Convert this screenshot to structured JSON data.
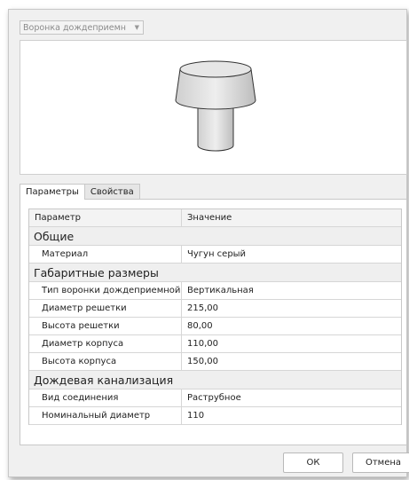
{
  "family_select": {
    "value": "Воронка дождеприемн"
  },
  "tabs": [
    {
      "label": "Параметры",
      "active": true
    },
    {
      "label": "Свойства",
      "active": false
    }
  ],
  "grid": {
    "columns": [
      "Параметр",
      "Значение"
    ],
    "groups": [
      {
        "name": "Общие",
        "rows": [
          {
            "param": "Материал",
            "value": "Чугун серый"
          }
        ]
      },
      {
        "name": "Габаритные размеры",
        "rows": [
          {
            "param": "Тип воронки дождеприемной",
            "value": "Вертикальная"
          },
          {
            "param": "Диаметр решетки",
            "value": "215,00"
          },
          {
            "param": "Высота решетки",
            "value": "80,00"
          },
          {
            "param": "Диаметр корпуса",
            "value": "110,00"
          },
          {
            "param": "Высота корпуса",
            "value": "150,00"
          }
        ]
      },
      {
        "name": "Дождевая канализация",
        "rows": [
          {
            "param": "Вид соединения",
            "value": "Раструбное"
          },
          {
            "param": "Номинальный диаметр",
            "value": "110"
          }
        ]
      }
    ]
  },
  "buttons": {
    "ok": "ОК",
    "cancel": "Отмена"
  },
  "colors": {
    "accent_border": "#c8c8c8",
    "group_bg": "#efefef"
  }
}
